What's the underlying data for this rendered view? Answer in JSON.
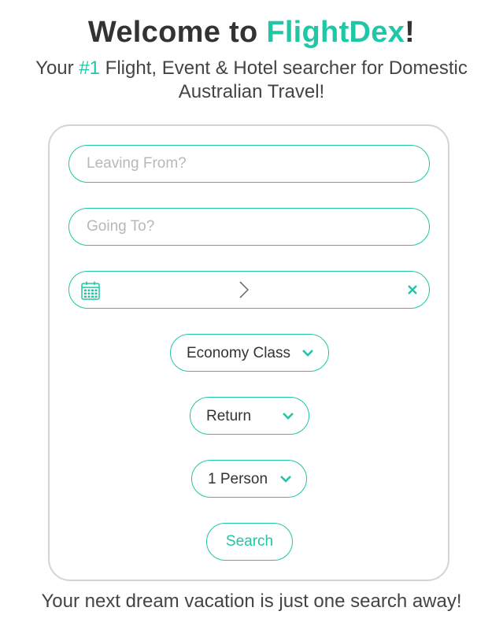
{
  "header": {
    "title_prefix": "Welcome to ",
    "title_brand": "FlightDex",
    "title_suffix": "!",
    "subtitle_prefix": "Your ",
    "subtitle_highlight": "#1",
    "subtitle_rest": " Flight, Event & Hotel searcher for Domestic Australian Travel!"
  },
  "form": {
    "leaving_from": {
      "value": "",
      "placeholder": "Leaving From?"
    },
    "going_to": {
      "value": "",
      "placeholder": "Going To?"
    },
    "date_range": {
      "icon_start": "calendar-icon",
      "icon_separator": "chevron-right-icon",
      "icon_clear": "close-icon"
    },
    "class_select": {
      "selected": "Economy Class",
      "icon": "chevron-down-icon"
    },
    "trip_type_select": {
      "selected": "Return",
      "icon": "chevron-down-icon"
    },
    "passengers_select": {
      "selected": "1 Person",
      "icon": "chevron-down-icon"
    },
    "search_label": "Search"
  },
  "footer": {
    "tagline": "Your next dream vacation is just one search away!"
  },
  "colors": {
    "accent": "#1fc7a6",
    "text": "#333333",
    "card_border": "#d4d4d4",
    "placeholder": "#b8b8b8"
  }
}
